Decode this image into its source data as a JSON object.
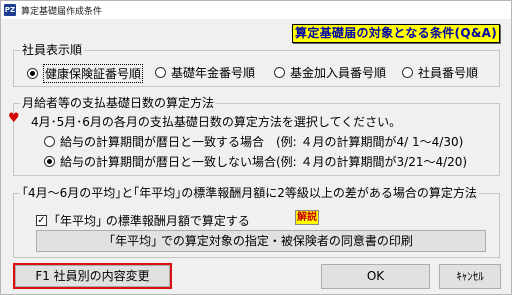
{
  "window": {
    "title": "算定基礎届作成条件",
    "icon_text": "PZ",
    "icon": "app-icon"
  },
  "qa_button": {
    "label": "算定基礎届の対象となる条件(Q&A)"
  },
  "employee_order": {
    "legend": "社員表示順",
    "options": [
      {
        "label": "健康保険証番号順",
        "selected": true
      },
      {
        "label": "基礎年金番号順",
        "selected": false
      },
      {
        "label": "基金加入員番号順",
        "selected": false
      },
      {
        "label": "社員番号順",
        "selected": false
      }
    ]
  },
  "salary_days": {
    "legend": "月給者等の支払基礎日数の算定方法",
    "instruction": "4月･5月･6月の各月の支払基礎日数の算定方法を選択してください。",
    "options": [
      {
        "label": "給与の計算期間が暦日と一致する場合　(例: ４月の計算期間が4/ 1〜4/30)",
        "selected": false
      },
      {
        "label": "給与の計算期間が暦日と一致しない場合(例: ４月の計算期間が3/21〜4/20)",
        "selected": true
      }
    ]
  },
  "average": {
    "legend": "｢4月〜6月の平均｣と｢年平均｣の標準報酬月額に2等級以上の差がある場合の算定方法",
    "checkbox_label": "｢年平均｣ の標準報酬月額で算定する",
    "checkbox_checked": true,
    "kaisetsu_label": "解説",
    "print_button": "｢年平均｣ での算定対象の指定・被保険者の同意書の印刷"
  },
  "footer": {
    "f1_button": "F1  社員別の内容変更",
    "ok_button": "OK",
    "cancel_button": "ｷｬﾝｾﾙ"
  },
  "colors": {
    "qa_bg": "#ffff00",
    "qa_text": "#0000aa",
    "highlight_outline": "#e01010",
    "heart": "#d40000"
  }
}
